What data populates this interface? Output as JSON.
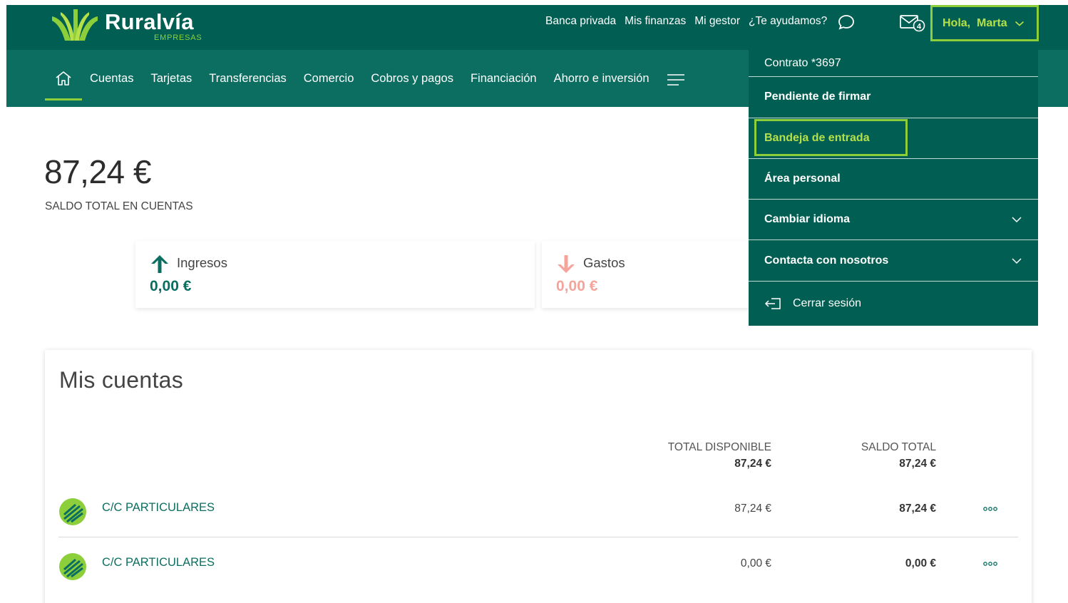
{
  "brand": {
    "name": "Ruralvía",
    "sub": "EMPRESAS",
    "accent": "#8ccf3a",
    "primary": "#005f52"
  },
  "header": {
    "links": [
      "Banca privada",
      "Mis finanzas",
      "Mi gestor",
      "¿Te ayudamos?"
    ],
    "mail_badge": "4",
    "greeting": "Hola,  Marta"
  },
  "nav": {
    "items": [
      "Cuentas",
      "Tarjetas",
      "Transferencias",
      "Comercio",
      "Cobros y pagos",
      "Financiación",
      "Ahorro e inversión"
    ]
  },
  "summary": {
    "balance": "87,24 €",
    "balance_label": "SALDO TOTAL EN CUENTAS",
    "income": {
      "label": "Ingresos",
      "amount": "0,00 €"
    },
    "expenses": {
      "label": "Gastos",
      "amount": "0,00 €"
    }
  },
  "user_menu": {
    "contract": "Contrato *3697",
    "pending": "Pendiente de firmar",
    "inbox": "Bandeja de entrada",
    "personal": "Área personal",
    "language": "Cambiar idioma",
    "contact": "Contacta con nosotros",
    "logout": "Cerrar sesión"
  },
  "accounts": {
    "title": "Mis cuentas",
    "col_available": "TOTAL DISPONIBLE",
    "col_total": "SALDO TOTAL",
    "sum_available": "87,24 €",
    "sum_total": "87,24 €",
    "rows": [
      {
        "name": "C/C PARTICULARES",
        "available": "87,24 €",
        "total": "87,24 €"
      },
      {
        "name": "C/C PARTICULARES",
        "available": "0,00 €",
        "total": "0,00 €"
      }
    ]
  }
}
